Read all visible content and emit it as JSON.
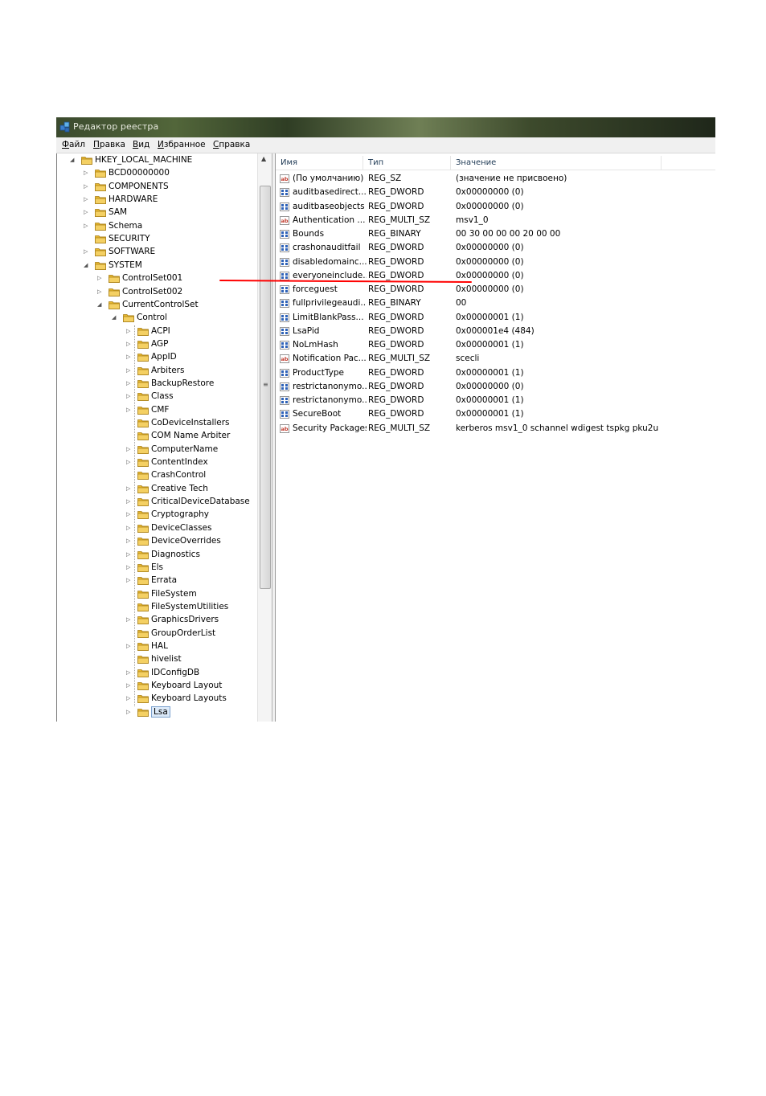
{
  "window": {
    "title": "Редактор реестра"
  },
  "menu": [
    "Файл",
    "Правка",
    "Вид",
    "Избранное",
    "Справка"
  ],
  "tree": [
    {
      "label": "HKEY_LOCAL_MACHINE",
      "arrow": "◢",
      "level": 0
    },
    {
      "label": "BCD00000000",
      "arrow": "▷",
      "level": 1
    },
    {
      "label": "COMPONENTS",
      "arrow": "▷",
      "level": 1
    },
    {
      "label": "HARDWARE",
      "arrow": "▷",
      "level": 1
    },
    {
      "label": "SAM",
      "arrow": "▷",
      "level": 1
    },
    {
      "label": "Schema",
      "arrow": "▷",
      "level": 1
    },
    {
      "label": "SECURITY",
      "arrow": "",
      "level": 1
    },
    {
      "label": "SOFTWARE",
      "arrow": "▷",
      "level": 1
    },
    {
      "label": "SYSTEM",
      "arrow": "◢",
      "level": 1
    },
    {
      "label": "ControlSet001",
      "arrow": "▷",
      "level": 2
    },
    {
      "label": "ControlSet002",
      "arrow": "▷",
      "level": 2
    },
    {
      "label": "CurrentControlSet",
      "arrow": "◢",
      "level": 2
    },
    {
      "label": "Control",
      "arrow": "◢",
      "level": 3
    },
    {
      "label": "ACPI",
      "arrow": "▷",
      "level": 4
    },
    {
      "label": "AGP",
      "arrow": "▷",
      "level": 4
    },
    {
      "label": "AppID",
      "arrow": "▷",
      "level": 4
    },
    {
      "label": "Arbiters",
      "arrow": "▷",
      "level": 4
    },
    {
      "label": "BackupRestore",
      "arrow": "▷",
      "level": 4
    },
    {
      "label": "Class",
      "arrow": "▷",
      "level": 4
    },
    {
      "label": "CMF",
      "arrow": "▷",
      "level": 4
    },
    {
      "label": "CoDeviceInstallers",
      "arrow": "",
      "level": 4
    },
    {
      "label": "COM Name Arbiter",
      "arrow": "",
      "level": 4
    },
    {
      "label": "ComputerName",
      "arrow": "▷",
      "level": 4
    },
    {
      "label": "ContentIndex",
      "arrow": "▷",
      "level": 4
    },
    {
      "label": "CrashControl",
      "arrow": "",
      "level": 4
    },
    {
      "label": "Creative Tech",
      "arrow": "▷",
      "level": 4
    },
    {
      "label": "CriticalDeviceDatabase",
      "arrow": "▷",
      "level": 4
    },
    {
      "label": "Cryptography",
      "arrow": "▷",
      "level": 4
    },
    {
      "label": "DeviceClasses",
      "arrow": "▷",
      "level": 4
    },
    {
      "label": "DeviceOverrides",
      "arrow": "▷",
      "level": 4
    },
    {
      "label": "Diagnostics",
      "arrow": "▷",
      "level": 4
    },
    {
      "label": "Els",
      "arrow": "▷",
      "level": 4
    },
    {
      "label": "Errata",
      "arrow": "▷",
      "level": 4
    },
    {
      "label": "FileSystem",
      "arrow": "",
      "level": 4
    },
    {
      "label": "FileSystemUtilities",
      "arrow": "",
      "level": 4
    },
    {
      "label": "GraphicsDrivers",
      "arrow": "▷",
      "level": 4
    },
    {
      "label": "GroupOrderList",
      "arrow": "",
      "level": 4
    },
    {
      "label": "HAL",
      "arrow": "▷",
      "level": 4
    },
    {
      "label": "hivelist",
      "arrow": "",
      "level": 4
    },
    {
      "label": "IDConfigDB",
      "arrow": "▷",
      "level": 4
    },
    {
      "label": "Keyboard Layout",
      "arrow": "▷",
      "level": 4
    },
    {
      "label": "Keyboard Layouts",
      "arrow": "▷",
      "level": 4
    },
    {
      "label": "Lsa",
      "arrow": "▷",
      "level": 4,
      "selected": true
    }
  ],
  "list": {
    "columns": [
      "Имя",
      "Тип",
      "Значение"
    ],
    "rows": [
      {
        "name": "(По умолчанию)",
        "type": "REG_SZ",
        "value": "(значение не присвоено)",
        "icon": "string"
      },
      {
        "name": "auditbasedirect...",
        "type": "REG_DWORD",
        "value": "0x00000000 (0)",
        "icon": "binary"
      },
      {
        "name": "auditbaseobjects",
        "type": "REG_DWORD",
        "value": "0x00000000 (0)",
        "icon": "binary"
      },
      {
        "name": "Authentication ...",
        "type": "REG_MULTI_SZ",
        "value": "msv1_0",
        "icon": "string"
      },
      {
        "name": "Bounds",
        "type": "REG_BINARY",
        "value": "00 30 00 00 00 20 00 00",
        "icon": "binary"
      },
      {
        "name": "crashonauditfail",
        "type": "REG_DWORD",
        "value": "0x00000000 (0)",
        "icon": "binary"
      },
      {
        "name": "disabledomainc...",
        "type": "REG_DWORD",
        "value": "0x00000000 (0)",
        "icon": "binary"
      },
      {
        "name": "everyoneinclude...",
        "type": "REG_DWORD",
        "value": "0x00000000 (0)",
        "icon": "binary"
      },
      {
        "name": "forceguest",
        "type": "REG_DWORD",
        "value": "0x00000000 (0)",
        "icon": "binary"
      },
      {
        "name": "fullprivilegeaudi...",
        "type": "REG_BINARY",
        "value": "00",
        "icon": "binary"
      },
      {
        "name": "LimitBlankPass...",
        "type": "REG_DWORD",
        "value": "0x00000001 (1)",
        "icon": "binary"
      },
      {
        "name": "LsaPid",
        "type": "REG_DWORD",
        "value": "0x000001e4 (484)",
        "icon": "binary"
      },
      {
        "name": "NoLmHash",
        "type": "REG_DWORD",
        "value": "0x00000001 (1)",
        "icon": "binary"
      },
      {
        "name": "Notification Pac...",
        "type": "REG_MULTI_SZ",
        "value": "scecli",
        "icon": "string"
      },
      {
        "name": "ProductType",
        "type": "REG_DWORD",
        "value": "0x00000001 (1)",
        "icon": "binary"
      },
      {
        "name": "restrictanonymo...",
        "type": "REG_DWORD",
        "value": "0x00000000 (0)",
        "icon": "binary"
      },
      {
        "name": "restrictanonymo...",
        "type": "REG_DWORD",
        "value": "0x00000001 (1)",
        "icon": "binary"
      },
      {
        "name": "SecureBoot",
        "type": "REG_DWORD",
        "value": "0x00000001 (1)",
        "icon": "binary"
      },
      {
        "name": "Security Packages",
        "type": "REG_MULTI_SZ",
        "value": "kerberos msv1_0 schannel wdigest tspkg pku2u",
        "icon": "string"
      }
    ]
  },
  "colors": {
    "highlight": "#ff0000",
    "folder": "#e8b830",
    "selection": "#dbe9f8"
  }
}
